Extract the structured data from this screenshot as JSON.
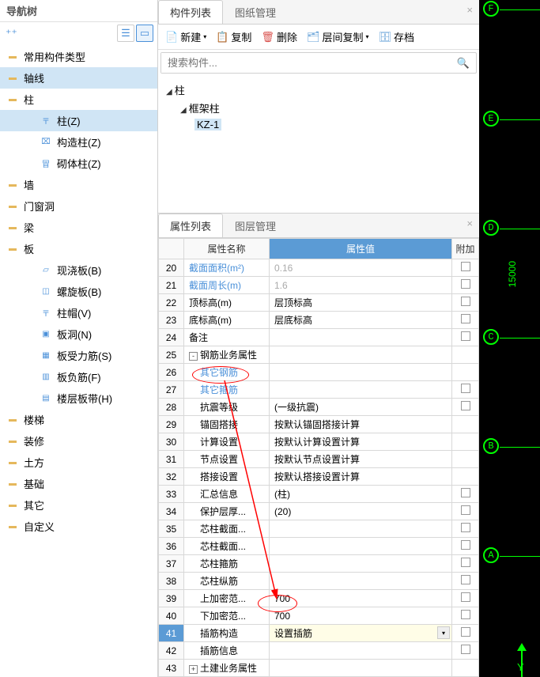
{
  "nav": {
    "title": "导航树",
    "categories": [
      "常用构件类型",
      "轴线",
      "柱",
      "墙",
      "门窗洞",
      "梁",
      "板",
      "楼梯",
      "装修",
      "土方",
      "基础",
      "其它",
      "自定义"
    ],
    "column_children": [
      {
        "label": "柱(Z)",
        "icon": "column"
      },
      {
        "label": "构造柱(Z)",
        "icon": "constr"
      },
      {
        "label": "砌体柱(Z)",
        "icon": "masonry"
      }
    ],
    "slab_children": [
      {
        "label": "现浇板(B)",
        "icon": "slab"
      },
      {
        "label": "螺旋板(B)",
        "icon": "spiral"
      },
      {
        "label": "柱帽(V)",
        "icon": "cap"
      },
      {
        "label": "板洞(N)",
        "icon": "hole"
      },
      {
        "label": "板受力筋(S)",
        "icon": "rebar"
      },
      {
        "label": "板负筋(F)",
        "icon": "neg"
      },
      {
        "label": "楼层板带(H)",
        "icon": "band"
      }
    ]
  },
  "comp_panel": {
    "tabs": [
      "构件列表",
      "图纸管理"
    ],
    "toolbar": [
      "新建",
      "复制",
      "删除",
      "层间复制",
      "存档"
    ],
    "search_placeholder": "搜索构件...",
    "tree": {
      "root": "柱",
      "sub": "框架柱",
      "leaf": "KZ-1"
    }
  },
  "prop_panel": {
    "tabs": [
      "属性列表",
      "图层管理"
    ],
    "headers": {
      "name": "属性名称",
      "value": "属性值",
      "addon": "附加"
    },
    "rows": [
      {
        "no": 20,
        "name": "截面面积(m²)",
        "value": "0.16",
        "grey": true,
        "addon": true
      },
      {
        "no": 21,
        "name": "截面周长(m)",
        "value": "1.6",
        "grey": true,
        "addon": true
      },
      {
        "no": 22,
        "name": "顶标高(m)",
        "value": "层顶标高",
        "addon": true
      },
      {
        "no": 23,
        "name": "底标高(m)",
        "value": "层底标高",
        "addon": true
      },
      {
        "no": 24,
        "name": "备注",
        "value": "",
        "addon": true
      },
      {
        "no": 25,
        "name": "钢筋业务属性",
        "value": "",
        "expand": "-",
        "indent": 0
      },
      {
        "no": 26,
        "name": "其它钢筋",
        "value": "",
        "link": true,
        "indent": 1
      },
      {
        "no": 27,
        "name": "其它箍筋",
        "value": "",
        "link": true,
        "indent": 1,
        "addon": true
      },
      {
        "no": 28,
        "name": "抗震等级",
        "value": "(一级抗震)",
        "indent": 1,
        "addon": true
      },
      {
        "no": 29,
        "name": "锚固搭接",
        "value": "按默认锚固搭接计算",
        "indent": 1
      },
      {
        "no": 30,
        "name": "计算设置",
        "value": "按默认计算设置计算",
        "indent": 1
      },
      {
        "no": 31,
        "name": "节点设置",
        "value": "按默认节点设置计算",
        "indent": 1
      },
      {
        "no": 32,
        "name": "搭接设置",
        "value": "按默认搭接设置计算",
        "indent": 1
      },
      {
        "no": 33,
        "name": "汇总信息",
        "value": "(柱)",
        "indent": 1,
        "addon": true
      },
      {
        "no": 34,
        "name": "保护层厚...",
        "value": "(20)",
        "indent": 1,
        "addon": true
      },
      {
        "no": 35,
        "name": "芯柱截面...",
        "value": "",
        "indent": 1,
        "addon": true
      },
      {
        "no": 36,
        "name": "芯柱截面...",
        "value": "",
        "indent": 1,
        "addon": true
      },
      {
        "no": 37,
        "name": "芯柱箍筋",
        "value": "",
        "indent": 1,
        "addon": true
      },
      {
        "no": 38,
        "name": "芯柱纵筋",
        "value": "",
        "indent": 1,
        "addon": true
      },
      {
        "no": 39,
        "name": "上加密范...",
        "value": "700",
        "indent": 1,
        "addon": true
      },
      {
        "no": 40,
        "name": "下加密范...",
        "value": "700",
        "indent": 1,
        "addon": true
      },
      {
        "no": 41,
        "name": "插筋构造",
        "value": "设置插筋",
        "indent": 1,
        "addon": true,
        "selected": true,
        "dropdown": true
      },
      {
        "no": 42,
        "name": "插筋信息",
        "value": "",
        "indent": 1,
        "addon": true
      },
      {
        "no": 43,
        "name": "土建业务属性",
        "value": "",
        "expand": "+",
        "indent": 0
      }
    ]
  },
  "cad": {
    "labels": [
      "F",
      "E",
      "D",
      "C",
      "B",
      "A"
    ],
    "dimension": "15000",
    "axis_y": "Y"
  }
}
